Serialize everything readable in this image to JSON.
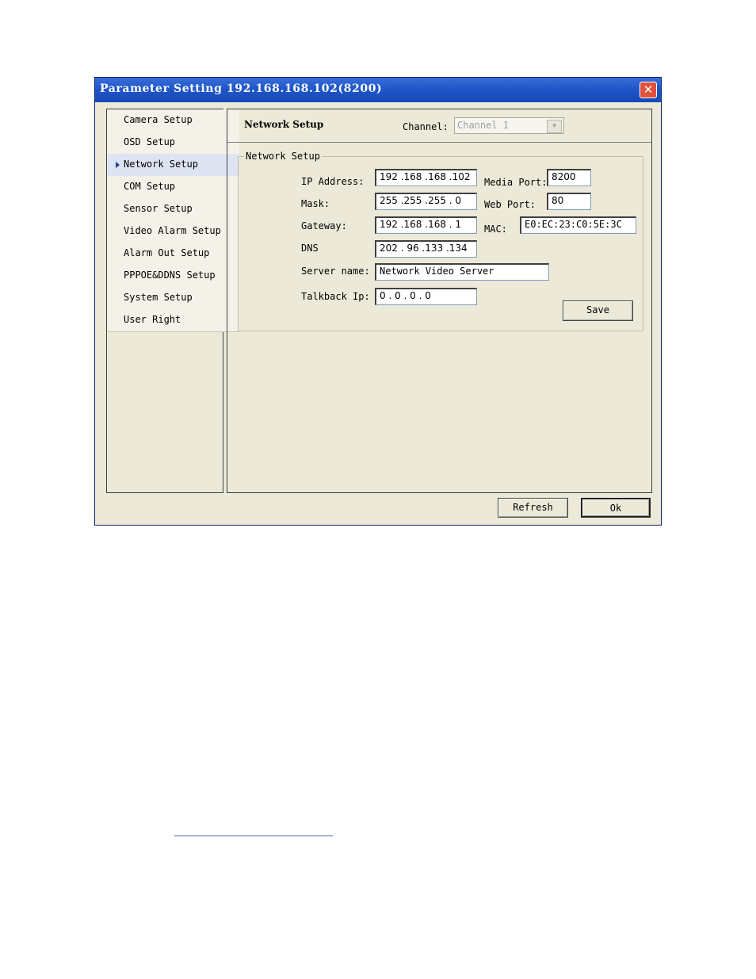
{
  "window": {
    "title": "Parameter Setting 192.168.168.102(8200)",
    "close_symbol": "✕"
  },
  "sidebar": {
    "items": [
      {
        "label": "Camera Setup",
        "active": false
      },
      {
        "label": "OSD Setup",
        "active": false
      },
      {
        "label": "Network Setup",
        "active": true
      },
      {
        "label": "COM Setup",
        "active": false
      },
      {
        "label": "Sensor Setup",
        "active": false
      },
      {
        "label": "Video Alarm Setup",
        "active": false
      },
      {
        "label": "Alarm Out Setup",
        "active": false
      },
      {
        "label": "PPPOE&DDNS Setup",
        "active": false
      },
      {
        "label": "System Setup",
        "active": false
      },
      {
        "label": "User Right",
        "active": false
      }
    ]
  },
  "header": {
    "title": "Network Setup",
    "channel_label": "Channel:",
    "channel_value": "Channel 1",
    "dropdown_arrow": "▼"
  },
  "group": {
    "legend": "Network Setup",
    "ip_label": "IP Address:",
    "ip_value": "192 .168 .168 .102",
    "mask_label": "Mask:",
    "mask_value": "255 .255 .255 . 0",
    "gateway_label": "Gateway:",
    "gateway_value": "192 .168 .168 . 1",
    "dns_label": "DNS",
    "dns_value": "202 . 96 .133 .134",
    "server_label": "Server name:",
    "server_value": "Network Video Server",
    "talkback_label": "Talkback Ip:",
    "talkback_value": " 0  . 0  . 0  . 0",
    "media_port_label": "Media Port:",
    "media_port_value": "8200",
    "web_port_label": "Web Port:",
    "web_port_value": "80",
    "mac_label": "MAC:",
    "mac_value": "E0:EC:23:C0:5E:3C",
    "save_label": "Save"
  },
  "footer": {
    "refresh_label": "Refresh",
    "ok_label": "Ok"
  },
  "colors": {
    "titlebar": "#1f56c9",
    "window_bg": "#ece9d8",
    "close": "#e0533a"
  }
}
